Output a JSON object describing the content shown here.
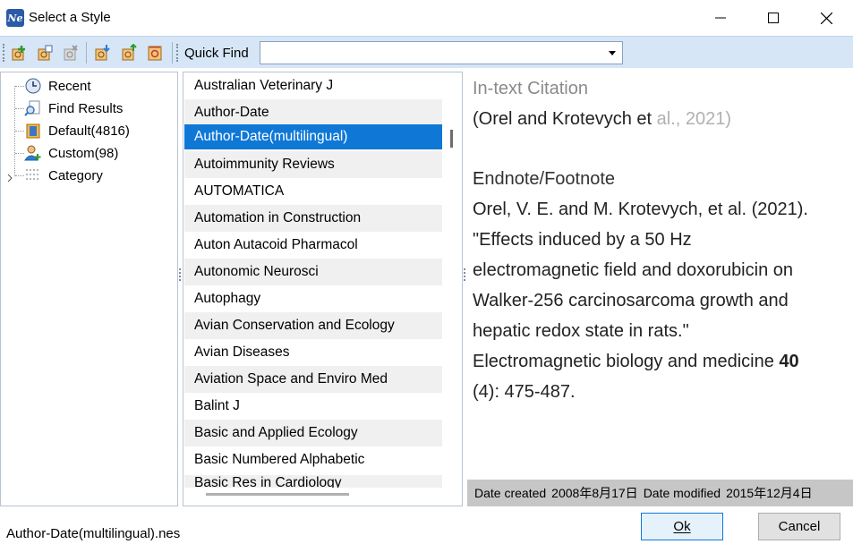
{
  "window": {
    "title": "Select a Style",
    "app_icon_text": "Ne"
  },
  "toolbar": {
    "quick_find_label": "Quick Find",
    "quick_find_value": ""
  },
  "tree": {
    "items": [
      {
        "label": "Recent",
        "icon": "clock-icon"
      },
      {
        "label": "Find Results",
        "icon": "find-results-icon"
      },
      {
        "label": "Default(4816)",
        "icon": "book-folder-icon"
      },
      {
        "label": "Custom(98)",
        "icon": "user-icon"
      },
      {
        "label": "Category",
        "icon": "grid-icon"
      }
    ]
  },
  "styles": {
    "items": [
      "Australian Veterinary J",
      "Author-Date",
      "Author-Date(multilingual)",
      "Autoimmunity Reviews",
      "AUTOMATICA",
      "Automation in Construction",
      "Auton Autacoid Pharmacol",
      "Autonomic Neurosci",
      "Autophagy",
      "Avian Conservation and Ecology",
      "Avian Diseases",
      "Aviation Space and Enviro Med",
      "Balint J",
      "Basic and Applied Ecology",
      "Basic Numbered Alphabetic",
      "Basic Res in Cardiology"
    ],
    "selected": "Author-Date(multilingual)"
  },
  "preview": {
    "intext_heading": "In-text Citation",
    "intext_part1": "(Orel and Krotevych et ",
    "intext_part2": "al., 2021)",
    "footnote_heading_first": "E",
    "footnote_heading_rest": "ndnote/Footnote",
    "ref_line1": "Orel, V. E. and M. Krotevych, et al. (2021).",
    "ref_line2": "\"Effects induced by a 50 Hz",
    "ref_line3": "electromagnetic field and doxorubicin on",
    "ref_line4": "Walker-256 carcinosarcoma growth and",
    "ref_line5": "hepatic redox state in rats.\"",
    "ref_line6_text": "Electromagnetic biology and medicine ",
    "ref_line6_bold": "40",
    "ref_line7": "(4): 475-487."
  },
  "dates": {
    "created_label": "Date created",
    "created_value": "2008年8月17日",
    "modified_label": "Date modified",
    "modified_value": "2015年12月4日"
  },
  "status": {
    "filename": "Author-Date(multilingual).nes"
  },
  "buttons": {
    "ok": "Ok",
    "cancel": "Cancel"
  }
}
